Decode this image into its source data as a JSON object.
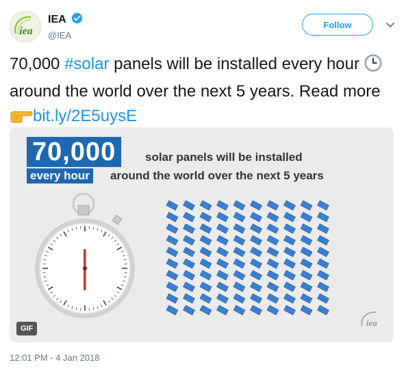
{
  "user": {
    "display_name": "IEA",
    "handle": "@IEA",
    "avatar_text": "iea",
    "verified_icon": "verified-badge-icon"
  },
  "actions": {
    "follow_label": "Follow",
    "menu_icon": "chevron-down-icon"
  },
  "tweet": {
    "text_part1": "70,000 ",
    "hashtag": "#solar",
    "text_part2": " panels will be installed every hour ",
    "emoji_clock": "clock-icon",
    "text_part3": " around the world over the next 5 years. Read more ",
    "emoji_pointing": "pointing-right-hand-icon",
    "link": "bit.ly/2E5uysE"
  },
  "media": {
    "headline_number": "70,000",
    "headline_line1": "solar panels will be installed",
    "headline_highlight": "every hour",
    "headline_line2": "around the world over the next 5 years",
    "gif_badge": "GIF",
    "watermark_text": "iea",
    "panel_rows": 10,
    "panel_cols": 10,
    "colors": {
      "brand_blue": "#1f68b1",
      "panel_blue": "#3c7fd0",
      "background": "#ebebeb"
    }
  },
  "timestamp": "12:01 PM - 4 Jan 2018",
  "colors": {
    "link": "#1b95e0",
    "follow": "#1da1f2",
    "muted": "#657786"
  }
}
